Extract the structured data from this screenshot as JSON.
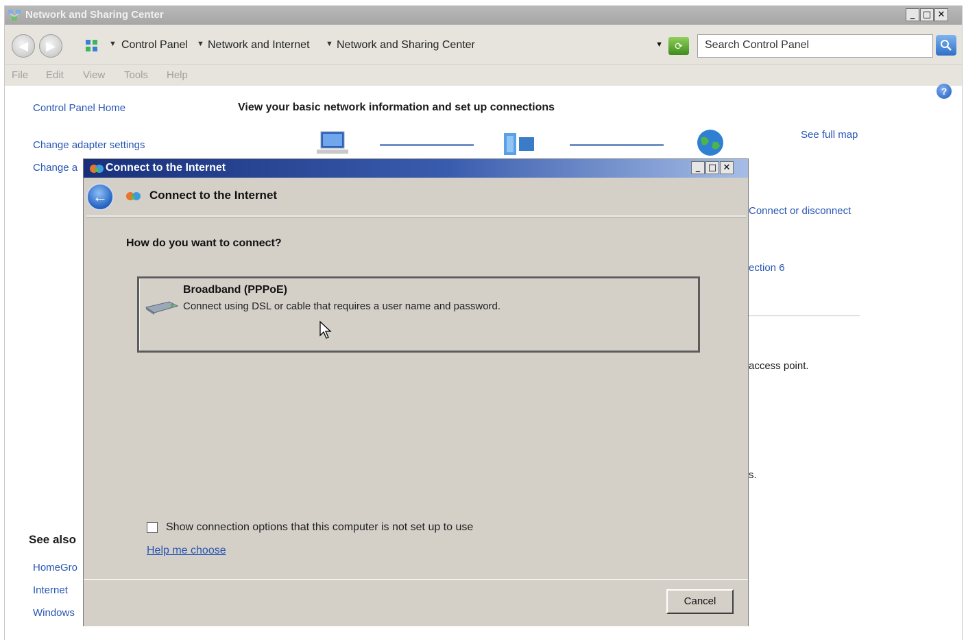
{
  "main_window": {
    "title": "Network and Sharing Center",
    "controls": {
      "minimize": "_",
      "maximize": "□",
      "close": "✕"
    },
    "address": {
      "crumbs": [
        "Control Panel",
        "Network and Internet",
        "Network and Sharing Center"
      ]
    },
    "search_placeholder": "Search Control Panel",
    "menu": [
      "File",
      "Edit",
      "View",
      "Tools",
      "Help"
    ],
    "sidebar": {
      "home": "Control Panel Home",
      "adapter": "Change adapter settings",
      "advanced_partial": "Change a",
      "see_also_title": "See also",
      "see_also": [
        "HomeGro",
        "Internet",
        "Windows"
      ]
    },
    "content": {
      "heading": "View your basic network information and set up connections",
      "see_full_map": "See full map",
      "connect_or_disconnect": "Connect or disconnect",
      "connection_partial": "ection 6",
      "access_point_partial": "access point.",
      "partial_s": "s."
    }
  },
  "dialog": {
    "title": "Connect to the Internet",
    "controls": {
      "minimize": "_",
      "maximize": "□",
      "close": "✕"
    },
    "header": "Connect to the Internet",
    "question": "How do you want to connect?",
    "option": {
      "title": "Broadband (PPPoE)",
      "description": "Connect using DSL or cable that requires a user name and password."
    },
    "checkbox_label": "Show connection options that this computer is not set up to use",
    "checkbox_checked": false,
    "help_link": "Help me choose",
    "cancel": "Cancel"
  }
}
